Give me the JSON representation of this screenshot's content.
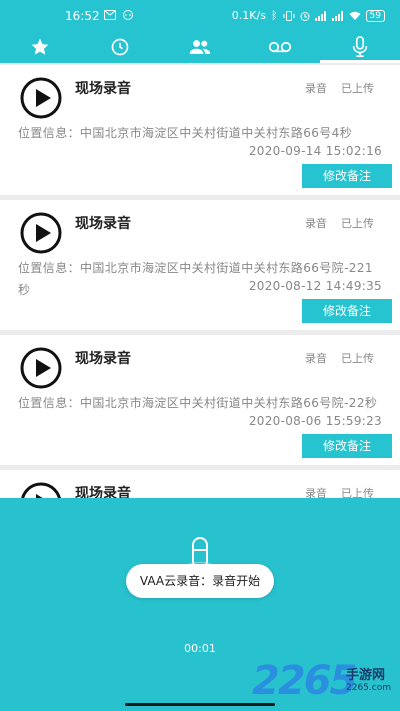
{
  "status_bar": {
    "time": "16:52",
    "network_speed": "0.1K/s",
    "battery": "59",
    "icons": [
      "mail-icon",
      "chat-icon",
      "bluetooth-icon",
      "vibrate-icon",
      "alarm-icon",
      "signal-icon",
      "wifi-icon",
      "battery-icon"
    ]
  },
  "tabs": [
    {
      "name": "favorites",
      "icon": "star-icon"
    },
    {
      "name": "history",
      "icon": "clock-icon"
    },
    {
      "name": "contacts",
      "icon": "people-icon"
    },
    {
      "name": "voicemail",
      "icon": "voicemail-icon"
    },
    {
      "name": "recording",
      "icon": "microphone-icon",
      "active": true
    }
  ],
  "recordings": [
    {
      "title": "现场录音",
      "type": "录音",
      "status": "已上传",
      "location": "位置信息：中国北京市海淀区中关村街道中关村东路66号4秒",
      "date": "2020-09-14 15:02:16",
      "edit_label": "修改备注"
    },
    {
      "title": "现场录音",
      "type": "录音",
      "status": "已上传",
      "location": "位置信息：中国北京市海淀区中关村街道中关村东路66号院-221秒",
      "date": "2020-08-12 14:49:35",
      "edit_label": "修改备注"
    },
    {
      "title": "现场录音",
      "type": "录音",
      "status": "已上传",
      "location": "位置信息：中国北京市海淀区中关村街道中关村东路66号院-22秒",
      "date": "2020-08-06 15:59:23",
      "edit_label": "修改备注"
    },
    {
      "title": "现场录音",
      "type": "录音",
      "status": "已上传"
    }
  ],
  "recording_panel": {
    "toast": "VAA云录音：录音开始",
    "timer": "00:01"
  },
  "watermark": {
    "number": "2265",
    "label": "手游网",
    "url": "2265.com"
  },
  "colors": {
    "accent": "#26c4d1",
    "text_secondary": "#888888",
    "card_bg": "#ffffff",
    "page_bg": "#ececec"
  }
}
